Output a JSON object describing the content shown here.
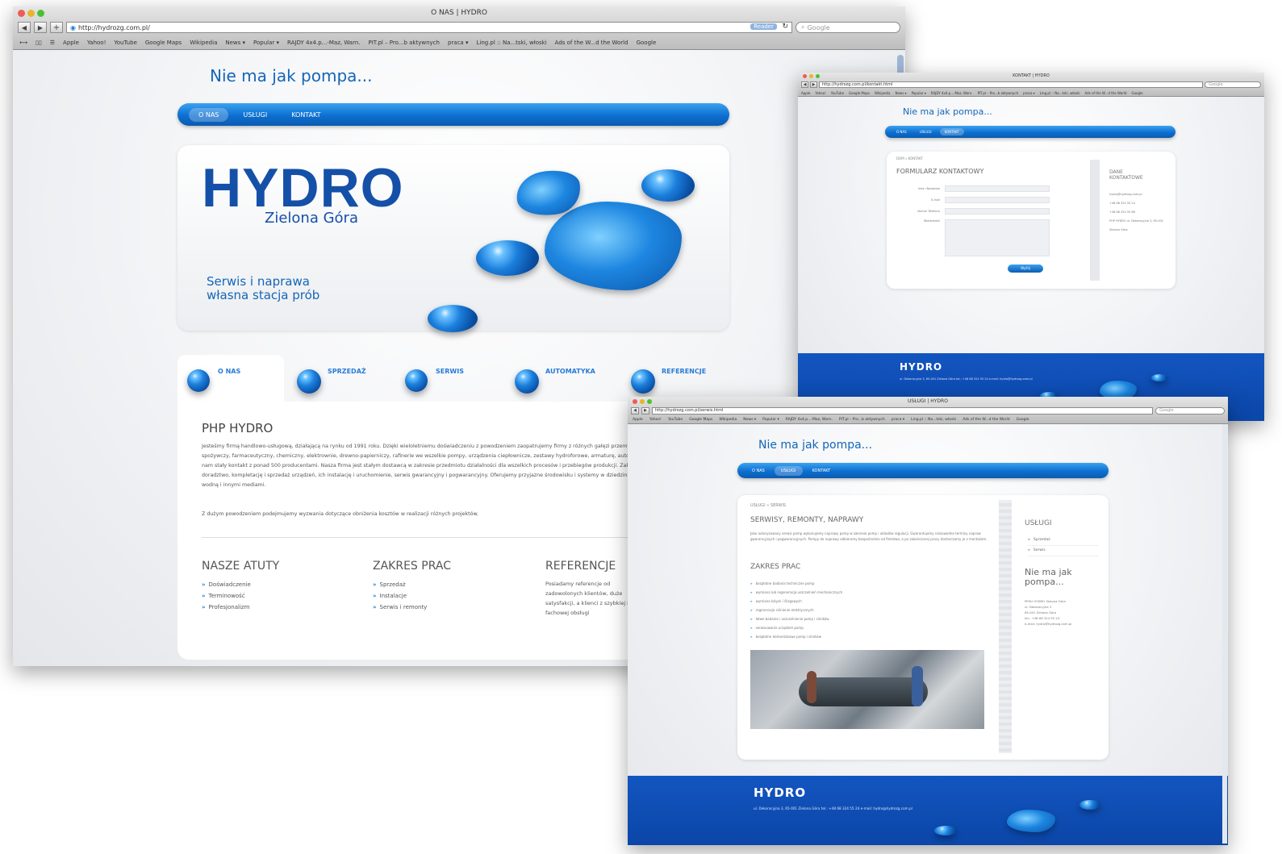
{
  "browser": {
    "main": {
      "title": "O NAS | HYDRO",
      "url": "http://hydrozg.com.pl/",
      "reader_label": "Reader",
      "search_placeholder": "Google",
      "bookmarks": [
        "Apple",
        "Yahoo!",
        "YouTube",
        "Google Maps",
        "Wikipedia",
        "News ▾",
        "Popular ▾",
        "RAJDY 4x4.p...-Maz, Warn.",
        "PIT.pl – Pro...b aktywnych",
        "praca ▾",
        "Ling.pl :: Na...tski, włoski",
        "Ads of the W...d the World",
        "Google"
      ]
    },
    "contact": {
      "title": "KONTAKT | HYDRO",
      "url": "http://hydrozg.com.pl/kontakt.html",
      "search_placeholder": "Google",
      "bookmarks": [
        "Apple",
        "Yahoo!",
        "YouTube",
        "Google Maps",
        "Wikipedia",
        "News ▾",
        "Popular ▾",
        "RAJDY 4x4.p...-Maz, Warn.",
        "PIT.pl – Pro...b aktywnych",
        "praca ▾",
        "Ling.pl :: Na...tski, włoski",
        "Ads of the W...d the World",
        "Google"
      ]
    },
    "services": {
      "title": "USŁUGI | HYDRO",
      "url": "http://hydrozg.com.pl/serwis.html",
      "search_placeholder": "Google",
      "bookmarks": [
        "Apple",
        "Yahoo!",
        "YouTube",
        "Google Maps",
        "Wikipedia",
        "News ▾",
        "Popular ▾",
        "RAJDY 4x4.p...-Maz, Warn.",
        "PIT.pl – Pro...b aktywnych",
        "praca ▾",
        "Ling.pl :: Na...tski, włoski",
        "Ads of the W...d the World",
        "Google"
      ]
    }
  },
  "site": {
    "tagline": "Nie ma jak pompa...",
    "menu": [
      "O NAS",
      "USŁUGI",
      "KONTAKT"
    ],
    "hero": {
      "logo": "HYDRO",
      "city": "Zielona Góra",
      "slogan_line1": "Serwis i naprawa",
      "slogan_line2": "własna stacja prób"
    },
    "tabs": [
      "O NAS",
      "SPRZEDAŻ",
      "SERWIS",
      "AUTOMATYKA",
      "REFERENCJE"
    ],
    "about": {
      "heading": "PHP HYDRO",
      "paragraph1": "Jesteśmy firmą handlowo-usługową, działającą na rynku od 1991 roku. Dzięki wieloletniemu doświadczeniu z powodzeniem zaopatrujemy firmy z różnych gałęzi przemysłu takich jak przemysł spożywczy, farmaceutyczny, chemiczny, elektrownie, drewno-papierniczy, rafinerie we wszelkie pompy, urządzenia ciepłownicze, zestawy hydroforowe, armaturę, automatykę. Możliwości takie daje nam stały kontakt z ponad 500 producentami. Nasza firma jest stałym dostawcą w zakresie przedmiotu działalności dla wszelkich procesów i przebiegów produkcji. Zakres działalności obejmuje doradztwo, kompletację i sprzedaż urządzeń, ich instalację i uruchomienie, serwis gwarancyjny i pogwarancyjny. Oferujemy przyjazne środowisku i systemy w dziedzinach związanych z gospodarką wodną i innymi mediami.",
      "paragraph2": "Z dużym powodzeniem podejmujemy wyzwania dotyczące obniżenia kosztów w realizacji różnych projektów."
    },
    "atuty": {
      "heading": "NASZE ATUTY",
      "items": [
        "Doświadczenie",
        "Terminowość",
        "Profesjonalizm"
      ]
    },
    "zakres": {
      "heading": "ZAKRES PRAC",
      "items": [
        "Sprzedaż",
        "Instalacje",
        "Serwis i remonty"
      ]
    },
    "referencje": {
      "heading": "REFERENCJE",
      "text": "Posiadamy referencje od zadowolonych klientów, duże satysfakcji, a klienci z szybkiej i fachowej obsługi"
    }
  },
  "contact_page": {
    "breadcrumb": "DOM » KONTAKT",
    "heading": "FORMULARZ KONTAKTOWY",
    "fields": [
      "Imię i Nazwisko",
      "E-mail",
      "Numer Telefonu",
      "Wiadomość"
    ],
    "send_label": "Wyślij",
    "side_heading": "DANE KONTAKTOWE",
    "side_items": [
      "hydro@hydrozg.com.pl",
      "+48 68 324 55 24",
      "+48 68 324 55 86",
      "PHP HYDRO ul. Dekoracyjna 3, 65-001 Zielona Góra"
    ]
  },
  "services_page": {
    "breadcrumb": "USŁUGI » SERWIS",
    "heading": "SERWISY, REMONTY, NAPRAWY",
    "intro": "Jako autoryzowany serwis pomp wykonujemy naprawy pomp w zakresie pomp i układów regulacji. Gwarantujemy niezawodne terminy napraw gwarancyjnych i pogwarancyjnych. Pompy do naprawy odbieramy bezpośrednio od Państwa, a po zakończonej pracy dostarczamy je z montażem.",
    "subheading": "ZAKRES PRAC",
    "items": [
      "bezpłatne badania techniczne pomp",
      "wymiana lub regeneracja uszczelnień mechanicznych",
      "wymiana łożysk i ślizgowych",
      "regeneracja ciśnienie elektrycznych",
      "łatwe badanie i uszczelnienie pomp i silników",
      "serwisowanie urządzeń pomp",
      "bezpłatne demontażowe pomp i silników"
    ],
    "side_heading": "USŁUGI",
    "side_items": [
      "Sprzedaż",
      "Serwis"
    ],
    "side_tagline": "Nie ma jak pompa...",
    "side_address": [
      "PPHU HYDRO Zielona Góra",
      "ul. Dekoracyjna 3",
      "65-001 Zielona Góra",
      "tel.: +48 68 324 55 24",
      "e-mail: hydro@hydrozg.com.pl"
    ]
  },
  "footer": {
    "logo": "HYDRO",
    "address": "ul. Dekoracyjna 3, 65-001 Zielona Góra tel.: +48 68 324 55 24 e-mail: hydro@hydrozg.com.pl"
  },
  "colors": {
    "accent": "#1466b8",
    "menu": "#0d6fd0",
    "footer": "#0b46a8"
  }
}
